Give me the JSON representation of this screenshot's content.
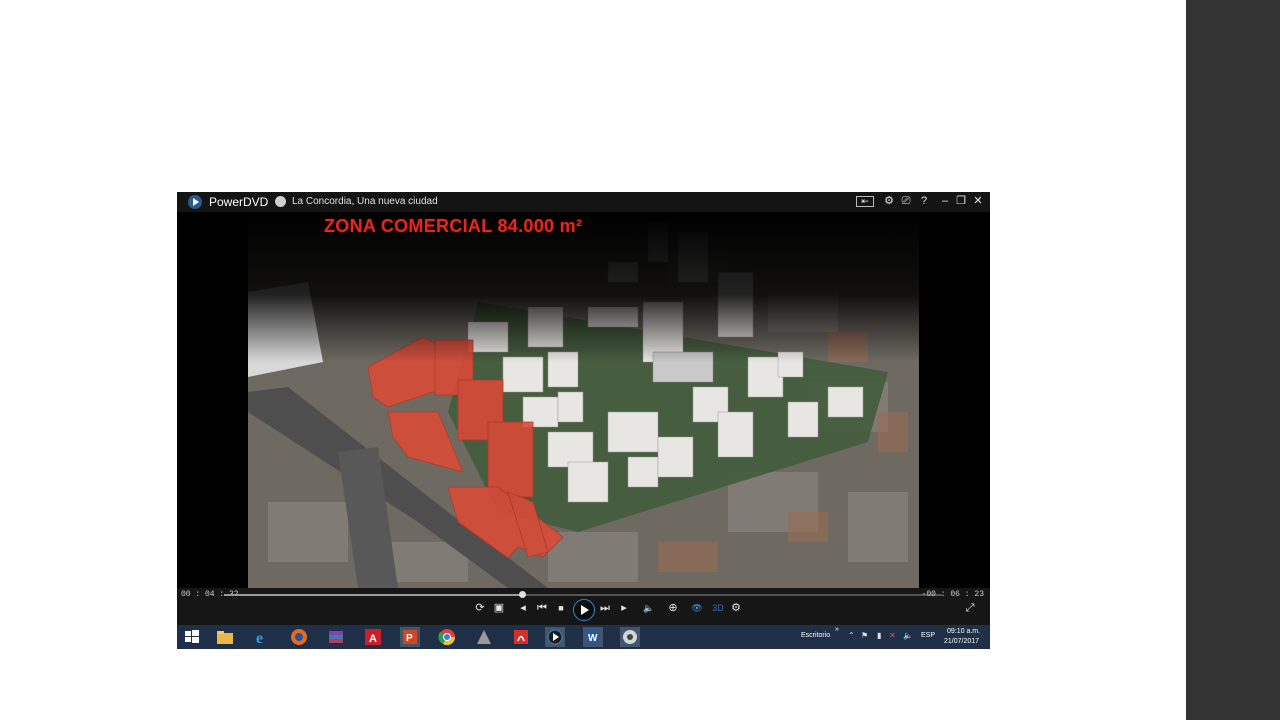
{
  "player": {
    "app_name": "PowerDVD",
    "video_title": "La Concordia, Una nueva ciudad",
    "titlebar_buttons": {
      "mini_mode": "⇤",
      "settings": "⚙",
      "tv_mode": "⎚",
      "help": "?",
      "minimize": "–",
      "restore": "❐",
      "close": "✕"
    },
    "video_caption": "ZONA COMERCIAL  84.000 m²",
    "time_elapsed": "00 : 04 : 32",
    "time_remaining": "-00 : 06 : 23",
    "seek_progress": 0.415,
    "controls": {
      "repeat": "⟳",
      "snapshot": "▣",
      "prev_frame": "◂",
      "prev_chapter": "⏮",
      "stop": "■",
      "next_chapter": "⏭",
      "next_frame": "▸",
      "volume": "🔈",
      "zoom": "⊕",
      "view": "👁",
      "three_d": "3D",
      "more": "⚙",
      "fullscreen": "⤢"
    },
    "accent_color": "#2b8fd8"
  },
  "taskbar": {
    "icons": [
      "windows-start-icon",
      "file-explorer-icon",
      "internet-explorer-icon",
      "firefox-icon",
      "winrar-icon",
      "autocad-icon",
      "powerpoint-icon",
      "chrome-icon",
      "app-icon",
      "acrobat-icon",
      "powerdvd-icon",
      "word-icon",
      "media-icon"
    ],
    "desktop_label": "Escritorio",
    "tray_chevron": "»",
    "language": "ESP",
    "time": "09:10 a.m.",
    "date": "21/07/2017"
  }
}
